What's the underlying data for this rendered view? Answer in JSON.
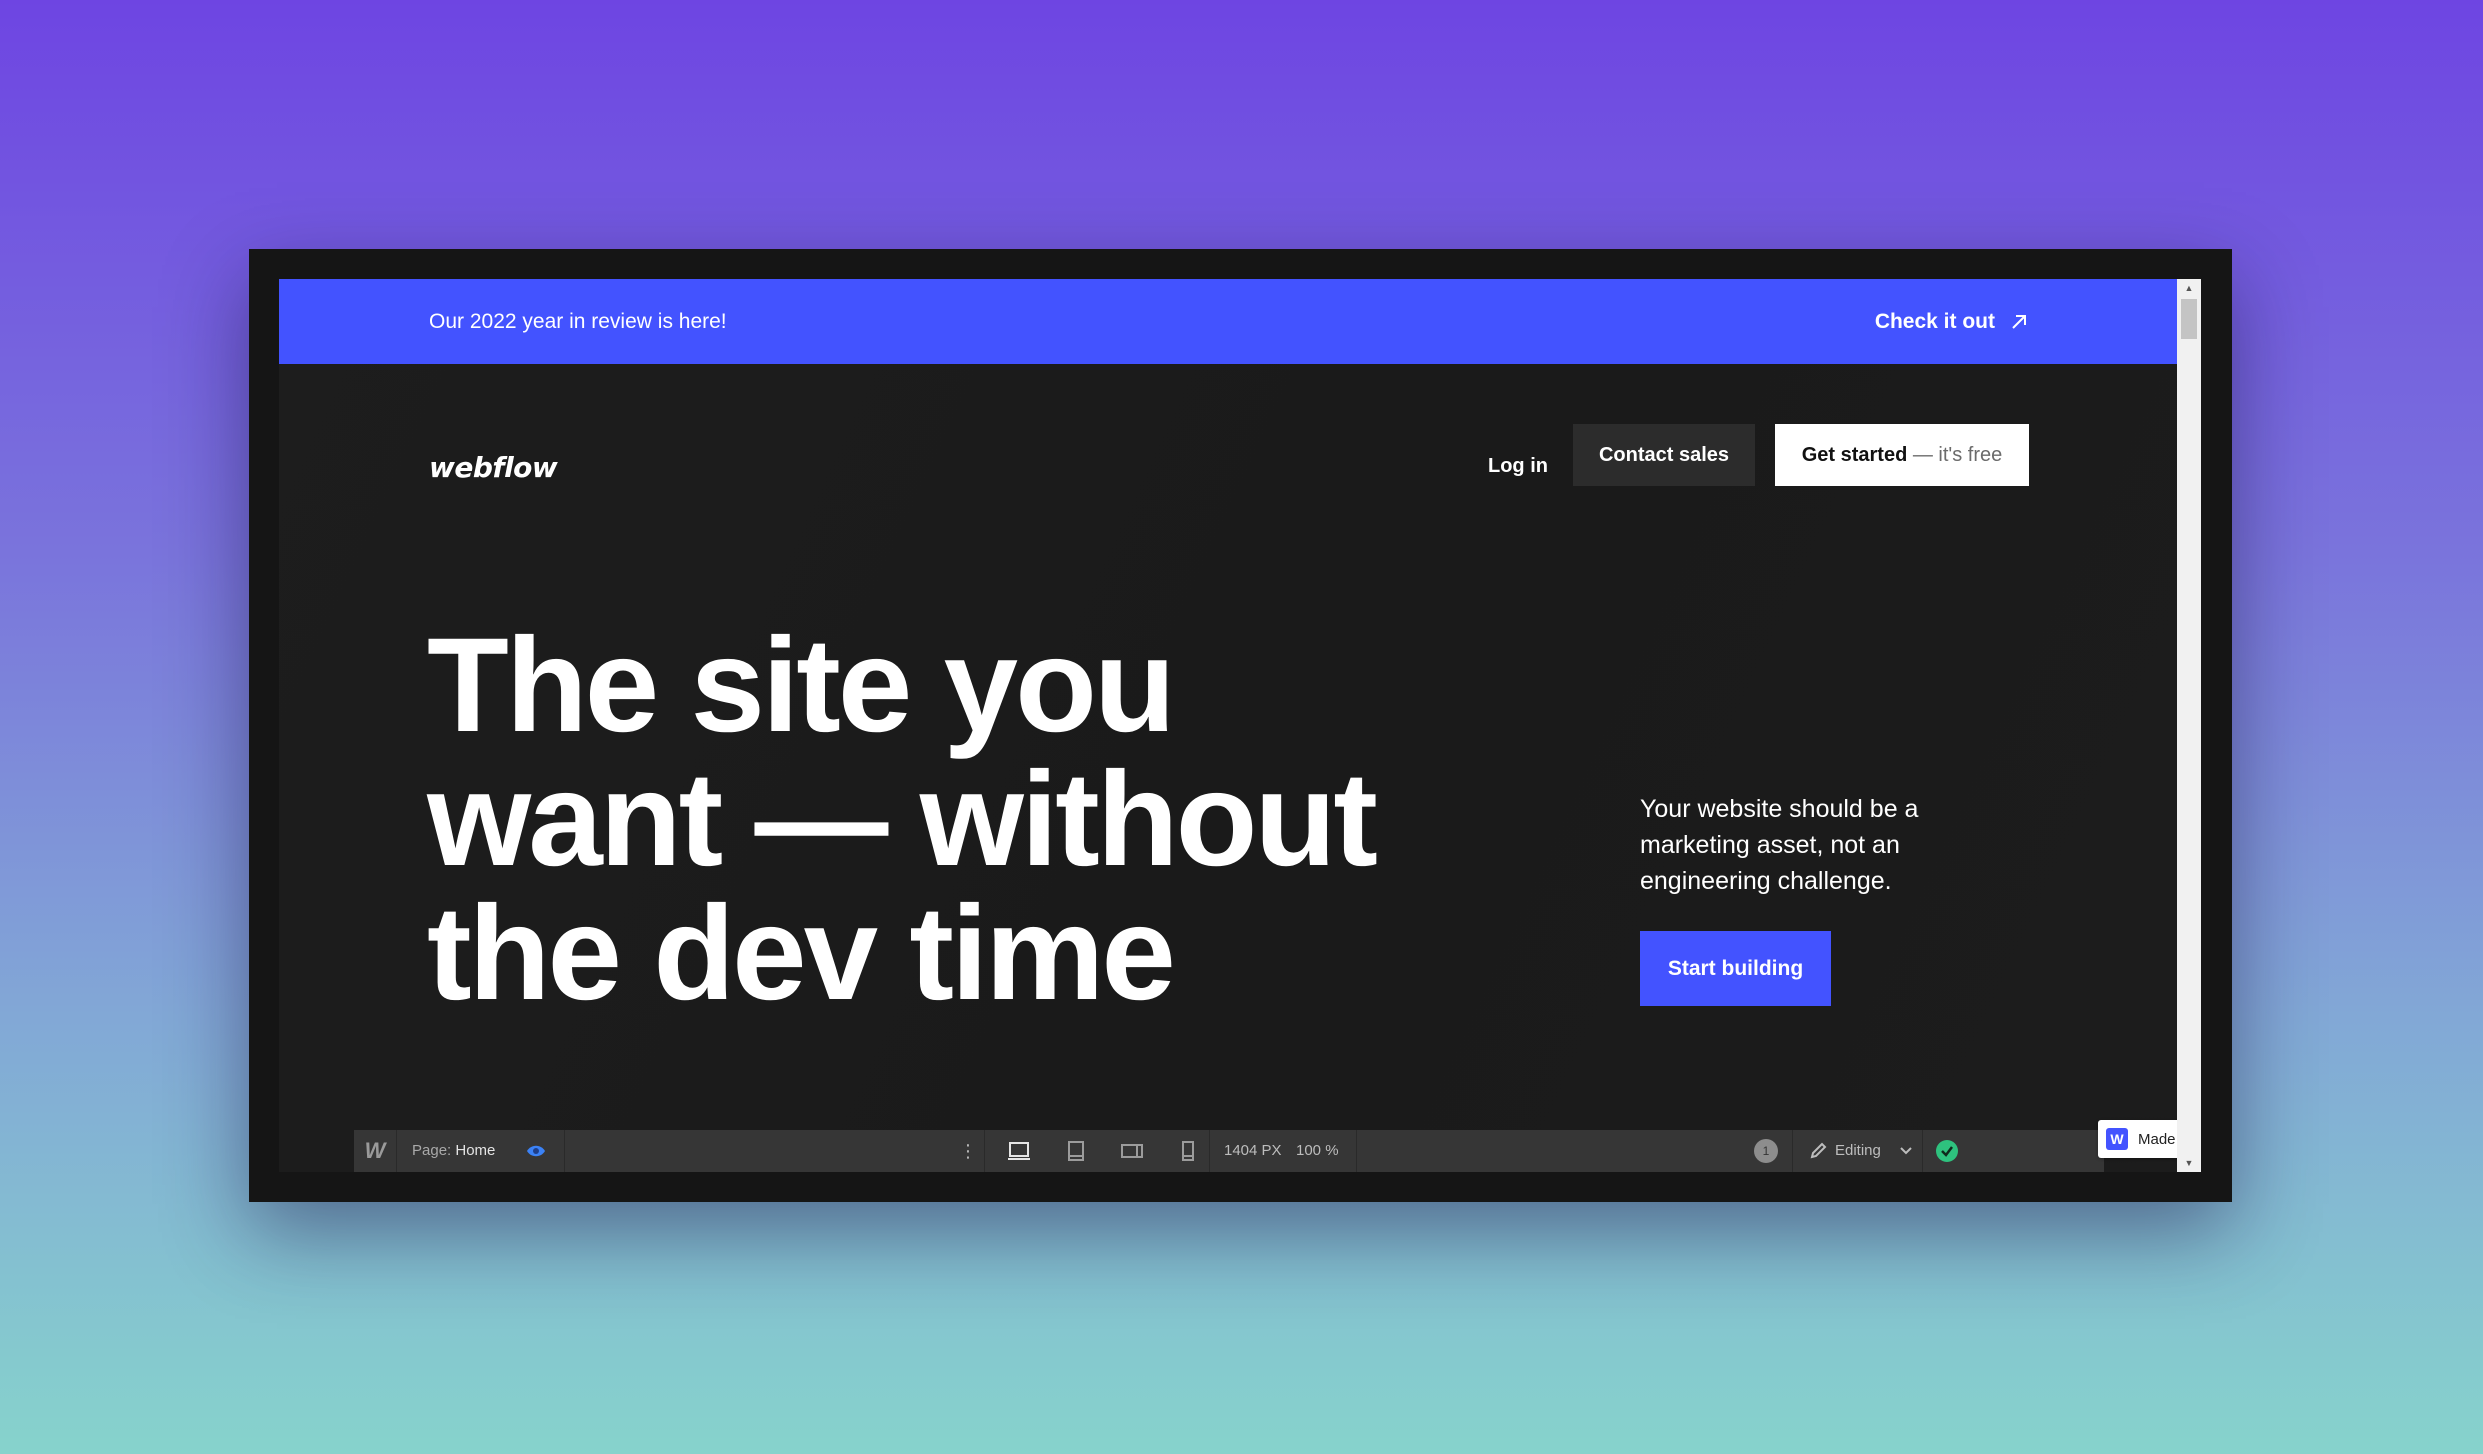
{
  "banner": {
    "text": "Our 2022 year in review is here!",
    "link_label": "Check it out"
  },
  "nav": {
    "logo": "webflow",
    "login": "Log in",
    "contact_sales": "Contact sales",
    "get_started": "Get started",
    "get_started_suffix": "— it's free"
  },
  "hero": {
    "title_line1": "The site you",
    "title_line2": "want — without",
    "title_line3": "the dev time",
    "description": "Your website should be a marketing asset, not an engineering challenge.",
    "cta": "Start building"
  },
  "toolbar": {
    "logo": "W",
    "page_label": "Page:",
    "page_name": "Home",
    "dots": "⋮",
    "width": "1404 PX",
    "zoom": "100 %",
    "badge": "1",
    "mode": "Editing"
  },
  "badge": {
    "label": "Made in Webflow",
    "logo": "W"
  },
  "colors": {
    "accent": "#4353ff",
    "dark": "#1b1b1b",
    "success": "#2ec27e"
  },
  "icons": [
    "arrow-up-right-icon",
    "eye-icon",
    "desktop-icon",
    "tablet-icon",
    "mobile-landscape-icon",
    "mobile-portrait-icon",
    "pencil-icon",
    "chevron-down-icon",
    "check-circle-icon"
  ]
}
